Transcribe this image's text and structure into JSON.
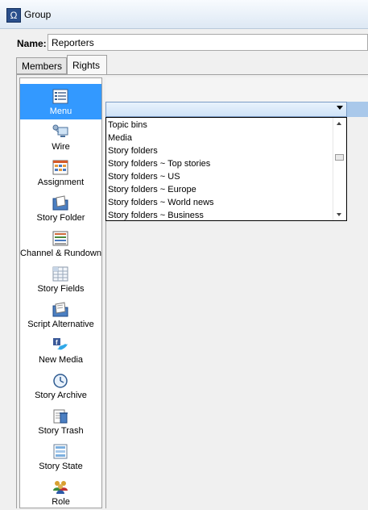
{
  "window": {
    "title": "Group",
    "app_icon_glyph": "Ω"
  },
  "name_field": {
    "label": "Name:",
    "value": "Reporters"
  },
  "tabs": [
    {
      "label": "Members"
    },
    {
      "label": "Rights",
      "active": true
    }
  ],
  "categories": [
    {
      "label": "Menu",
      "icon": "menu-icon",
      "selected": true
    },
    {
      "label": "Wire",
      "icon": "wire-icon"
    },
    {
      "label": "Assignment",
      "icon": "assignment-icon"
    },
    {
      "label": "Story Folder",
      "icon": "story-folder-icon"
    },
    {
      "label": "Channel & Rundown",
      "icon": "channel-rundown-icon"
    },
    {
      "label": "Story Fields",
      "icon": "story-fields-icon"
    },
    {
      "label": "Script Alternative",
      "icon": "script-alternative-icon"
    },
    {
      "label": "New Media",
      "icon": "new-media-icon"
    },
    {
      "label": "Story Archive",
      "icon": "story-archive-icon"
    },
    {
      "label": "Story Trash",
      "icon": "story-trash-icon"
    },
    {
      "label": "Story State",
      "icon": "story-state-icon"
    },
    {
      "label": "Role",
      "icon": "role-icon"
    }
  ],
  "dropdown": {
    "selected_value": "",
    "options": [
      "Topic bins",
      "Media",
      "Story folders",
      "Story folders ~ Top stories",
      "Story folders ~ US",
      "Story folders ~ Europe",
      "Story folders ~ World news",
      "Story folders ~ Business"
    ]
  },
  "colors": {
    "selection": "#3399ff",
    "accent_blue": "#2a4f8c"
  }
}
